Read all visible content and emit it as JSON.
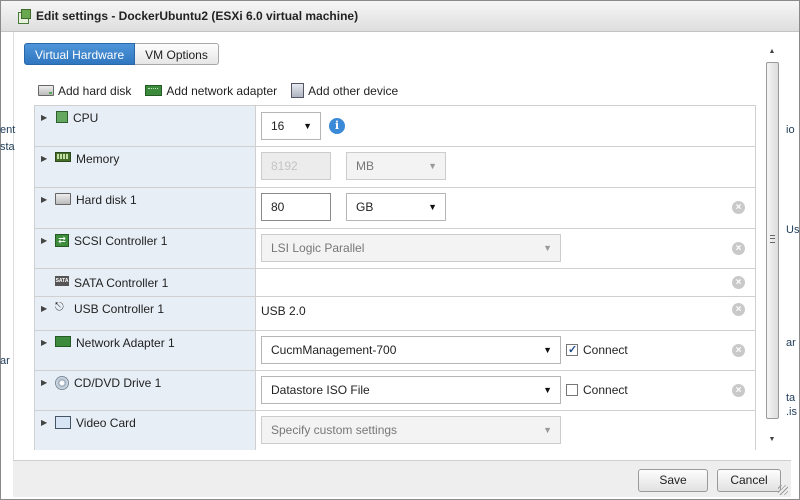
{
  "dialog": {
    "title": "Edit settings - DockerUbuntu2 (ESXi 6.0 virtual machine)"
  },
  "tabs": [
    {
      "label": "Virtual Hardware",
      "active": true
    },
    {
      "label": "VM Options",
      "active": false
    }
  ],
  "toolbar": {
    "add_hard_disk": "Add hard disk",
    "add_network_adapter": "Add network adapter",
    "add_other_device": "Add other device"
  },
  "devices": {
    "cpu": {
      "label": "CPU",
      "value": "16"
    },
    "memory": {
      "label": "Memory",
      "value": "8192",
      "unit": "MB"
    },
    "hard_disk": {
      "label": "Hard disk 1",
      "value": "80",
      "unit": "GB"
    },
    "scsi": {
      "label": "SCSI Controller 1",
      "value": "LSI Logic Parallel"
    },
    "sata": {
      "label": "SATA Controller 1",
      "icon_text": "SATA"
    },
    "usb": {
      "label": "USB Controller 1",
      "value": "USB 2.0"
    },
    "network": {
      "label": "Network Adapter 1",
      "value": "CucmManagement-700",
      "connect_label": "Connect",
      "connected": true
    },
    "cd": {
      "label": "CD/DVD Drive 1",
      "value": "Datastore ISO File",
      "connect_label": "Connect",
      "connected": false
    },
    "video": {
      "label": "Video Card",
      "value": "Specify custom settings"
    }
  },
  "footer": {
    "save_label": "Save",
    "cancel_label": "Cancel"
  },
  "background": {
    "frag_left_1": "ent",
    "frag_left_2": "sta",
    "frag_left_3": "ar",
    "frag_right_1": "io",
    "frag_right_2": "Us",
    "frag_right_3": "ar",
    "frag_right_4": "ta",
    "frag_right_5": ".is"
  },
  "colors": {
    "tab_active": "#2f76c0",
    "row_label_bg": "#e7eef6",
    "info_icon": "#3a8ad8"
  }
}
